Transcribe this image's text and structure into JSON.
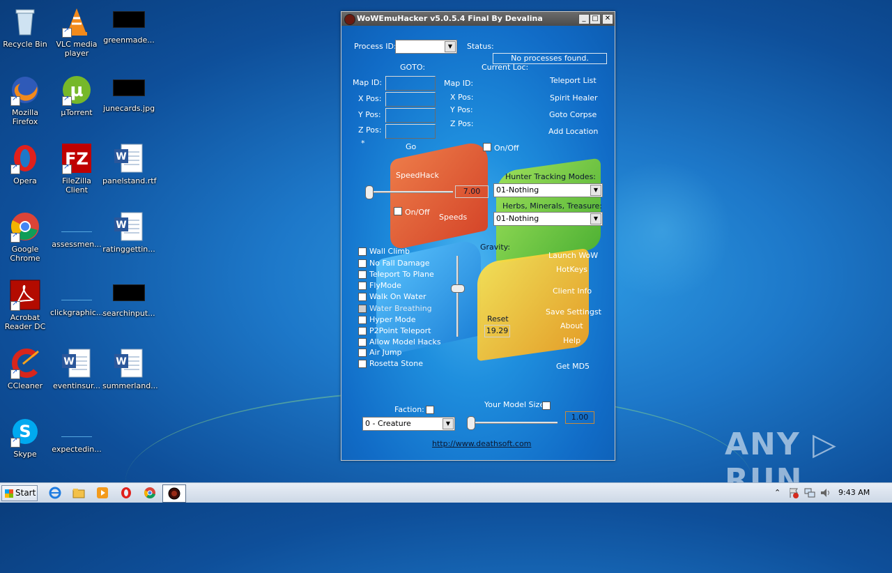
{
  "desktop": {
    "icons": [
      {
        "label": "Recycle Bin"
      },
      {
        "label": "VLC media player"
      },
      {
        "label": "greenmade..."
      },
      {
        "label": "Mozilla Firefox"
      },
      {
        "label": "µTorrent"
      },
      {
        "label": "junecards.jpg"
      },
      {
        "label": "Opera"
      },
      {
        "label": "FileZilla Client"
      },
      {
        "label": "panelstand.rtf"
      },
      {
        "label": "Google Chrome"
      },
      {
        "label": "assessmen..."
      },
      {
        "label": "ratinggettin..."
      },
      {
        "label": "Acrobat Reader DC"
      },
      {
        "label": "clickgraphic..."
      },
      {
        "label": "searchinput..."
      },
      {
        "label": "CCleaner"
      },
      {
        "label": "eventinsur..."
      },
      {
        "label": "summerland..."
      },
      {
        "label": "Skype"
      },
      {
        "label": "expectedin..."
      }
    ]
  },
  "window": {
    "title": "WoWEmuHacker v5.0.5.4 Final   By Devalina",
    "minimize": "_",
    "maximize": "□",
    "close": "✕",
    "process_id_label": "Process ID:",
    "process_id_value": "",
    "status_label": "Status:",
    "status_value": "No processes found.",
    "goto_label": "GOTO:",
    "current_loc_label": "Current Loc:",
    "goto_fields": [
      "Map ID:",
      "X Pos:",
      "Y Pos:",
      "Z Pos:"
    ],
    "current_fields": [
      "Map ID:",
      "X Pos:",
      "Y Pos:",
      "Z Pos:"
    ],
    "asterisk": "*",
    "go_label": "Go",
    "onoff_goto": "On/Off",
    "teleport_links": [
      "Teleport List",
      "Spirit Healer",
      "Goto Corpse",
      "Add Location"
    ],
    "speedhack_label": "SpeedHack",
    "speedhack_value": "7.00",
    "speed_onoff": "On/Off",
    "speeds_label": "Speeds",
    "hunter_label": "Hunter Tracking Modes:",
    "hunter_value": "01-Nothing",
    "herbs_label": "Herbs, Minerals, Treasure:",
    "herbs_value": "01-Nothing",
    "gravity_label": "Gravity:",
    "reset_label": "Reset",
    "gravity_value": "19.29",
    "hacks": [
      "Wall Climb",
      "No Fall Damage",
      "Teleport To Plane",
      "FlyMode",
      "Walk On Water",
      "Water Breathing",
      "Hyper Mode",
      "P2Point Teleport",
      "Allow Model Hacks",
      "Air Jump",
      "Rosetta Stone"
    ],
    "right_links": [
      "Launch WoW",
      "HotKeys",
      "Client Info",
      "Save Settingst",
      "About",
      "Help",
      "Get MD5"
    ],
    "faction_label": "Faction:",
    "faction_value": "0 - Creature",
    "model_size_label": "Your Model Size:",
    "model_size_value": "1.00",
    "url": "http://www.deathsoft.com"
  },
  "taskbar": {
    "start_label": "Start",
    "tray_arrow": "⌃",
    "clock": "9:43 AM"
  },
  "watermark": "ANY ▷ RUN"
}
